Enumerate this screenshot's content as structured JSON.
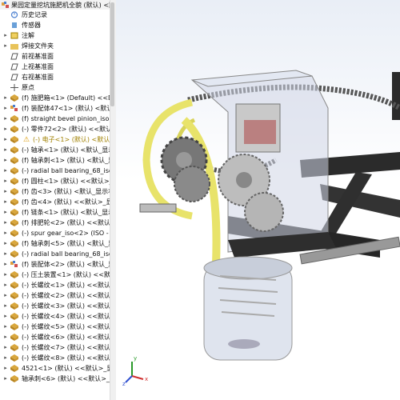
{
  "feature_tree": {
    "root_label": "果园定量挖坑施肥机全貌 (默认) <默认",
    "items": [
      {
        "label": "历史记录",
        "icon": "history-icon",
        "expand": ""
      },
      {
        "label": "传感器",
        "icon": "sensor-icon",
        "expand": ""
      },
      {
        "label": "注解",
        "icon": "annotation-icon",
        "expand": "▸"
      },
      {
        "label": "焊接文件夹",
        "icon": "folder-icon",
        "expand": "▸"
      },
      {
        "label": "前视基准面",
        "icon": "plane-icon",
        "expand": ""
      },
      {
        "label": "上视基准面",
        "icon": "plane-icon",
        "expand": ""
      },
      {
        "label": "右视基准面",
        "icon": "plane-icon",
        "expand": ""
      },
      {
        "label": "原点",
        "icon": "origin-icon",
        "expand": ""
      },
      {
        "label": "(f) 施肥箱<1> (Default) <<Defa",
        "icon": "part-icon",
        "expand": "▸"
      },
      {
        "label": "(f) 装配体47<1> (默认) <默认_显",
        "icon": "assembly-icon",
        "expand": "▸"
      },
      {
        "label": "(f) straight bevel pinion_iso<1",
        "icon": "part-icon",
        "expand": "▸"
      },
      {
        "label": "(-) 零件72<2> (默认) <<默认>_显",
        "icon": "part-icon",
        "expand": "▸"
      },
      {
        "label": "(-) 电子<1> (默认) <默认_显",
        "icon": "part-icon",
        "expand": "▸",
        "warning": true
      },
      {
        "label": "(-) 轴承<1> (默认) <默认_显示状",
        "icon": "part-icon",
        "expand": "▸"
      },
      {
        "label": "(f) 轴承刺<1> (默认) <默认_显示",
        "icon": "part-icon",
        "expand": "▸"
      },
      {
        "label": "(-) radial ball bearing_68_iso<",
        "icon": "part-icon",
        "expand": "▸"
      },
      {
        "label": "(f) 圆柱<1> (默认) <<默认>_显示",
        "icon": "part-icon",
        "expand": "▸"
      },
      {
        "label": "(f) 齿<3> (默认) <默认_显示状",
        "icon": "part-icon",
        "expand": "▸"
      },
      {
        "label": "(f) 齿<4> (默认) <<默认>_显示",
        "icon": "part-icon",
        "expand": "▸"
      },
      {
        "label": "(f) 链条<1> (默认) <默认_显示状",
        "icon": "part-icon",
        "expand": "▸"
      },
      {
        "label": "(f) 排肥轮<2> (默认) <<默认>_显",
        "icon": "part-icon",
        "expand": "▸"
      },
      {
        "label": "(-) spur gear_iso<2> (ISO - Sp",
        "icon": "part-icon",
        "expand": "▸"
      },
      {
        "label": "(f) 轴承刺<5> (默认) <默认_显示",
        "icon": "part-icon",
        "expand": "▸"
      },
      {
        "label": "(-) radial ball bearing_68_iso<",
        "icon": "part-icon",
        "expand": "▸"
      },
      {
        "label": "(f) 装配体<2> (默认) <默认_显",
        "icon": "assembly-icon",
        "expand": "▸"
      },
      {
        "label": "(-) 压土装置<1> (默认) <<默认",
        "icon": "part-icon",
        "expand": "▸"
      },
      {
        "label": "(-) 长螺纹<1> (默认) <<默认>_",
        "icon": "part-icon",
        "expand": "▸"
      },
      {
        "label": "(-) 长螺纹<2> (默认) <<默认>_",
        "icon": "part-icon",
        "expand": "▸"
      },
      {
        "label": "(-) 长螺纹<3> (默认) <<默认>_",
        "icon": "part-icon",
        "expand": "▸"
      },
      {
        "label": "(-) 长螺纹<4> (默认) <<默认>_",
        "icon": "part-icon",
        "expand": "▸"
      },
      {
        "label": "(-) 长螺纹<5> (默认) <<默认>_",
        "icon": "part-icon",
        "expand": "▸"
      },
      {
        "label": "(-) 长螺纹<6> (默认) <<默认>_",
        "icon": "part-icon",
        "expand": "▸"
      },
      {
        "label": "(-) 长螺纹<7> (默认) <<默认>_",
        "icon": "part-icon",
        "expand": "▸"
      },
      {
        "label": "(-) 长螺纹<8> (默认) <<默认>_",
        "icon": "part-icon",
        "expand": "▸"
      },
      {
        "label": "4521<1> (默认) <<默认>_显示",
        "icon": "part-icon",
        "expand": "▸"
      },
      {
        "label": "轴承刺<6> (默认) <<默认>_显",
        "icon": "part-icon",
        "expand": "▸"
      }
    ]
  },
  "viewport": {
    "triad_labels": {
      "x": "x",
      "y": "y",
      "z": "z"
    },
    "colors": {
      "frame": "#2b2b2b",
      "bracket": "#e8e36a",
      "gear": "#b9b9b9",
      "glass": "#cfd6e6",
      "chain": "#555555",
      "accent": "#d04040"
    }
  }
}
